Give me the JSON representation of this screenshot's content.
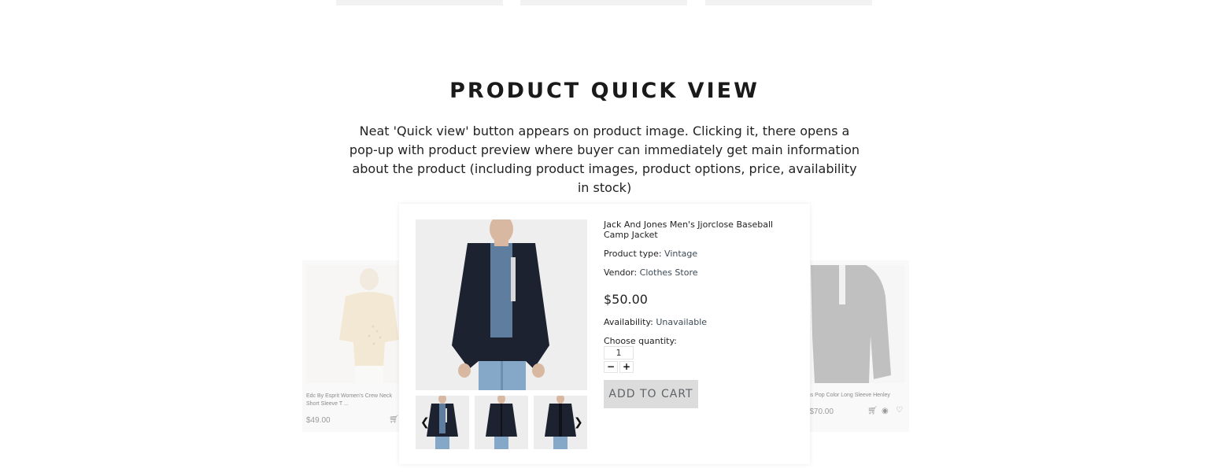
{
  "section": {
    "title": "PRODUCT QUICK VIEW",
    "description": "Neat 'Quick view' button appears on product image. Clicking it, there opens a pop-up with product preview where buyer can immediately get main information about the product (including product images, product options, price, availability in stock)"
  },
  "background_products": {
    "left": {
      "name": "Edc By Esprit Women's Crew Neck Short Sleeve T ...",
      "price": "$49.00"
    },
    "right": {
      "name": "...ns Pop Color Long Sleeve Henley",
      "price": "– $70.00"
    }
  },
  "quick_view": {
    "product_title": "Jack And Jones Men's Jjorclose Baseball Camp Jacket",
    "product_type_label": "Product type:",
    "product_type_value": "Vintage",
    "vendor_label": "Vendor:",
    "vendor_value": "Clothes Store",
    "price": "$50.00",
    "availability_label": "Availability:",
    "availability_value": "Unavailable",
    "quantity_label": "Choose quantity:",
    "quantity_value": "1",
    "add_to_cart_label": "ADD TO CART",
    "thumbnails": [
      "jacket-front-open",
      "jacket-front-closed",
      "jacket-front-alt"
    ]
  },
  "icons": {
    "prev": "chevron-left-icon",
    "next": "chevron-right-icon",
    "minus": "minus-icon",
    "plus": "plus-icon",
    "cart": "cart-icon",
    "eye": "eye-icon",
    "heart": "heart-icon"
  },
  "colors": {
    "button_bg": "#dcdcdc",
    "button_text": "#5f6469",
    "image_bg": "#eeeeee",
    "jacket": "#1c2230",
    "jeans": "#7fa3c4"
  }
}
